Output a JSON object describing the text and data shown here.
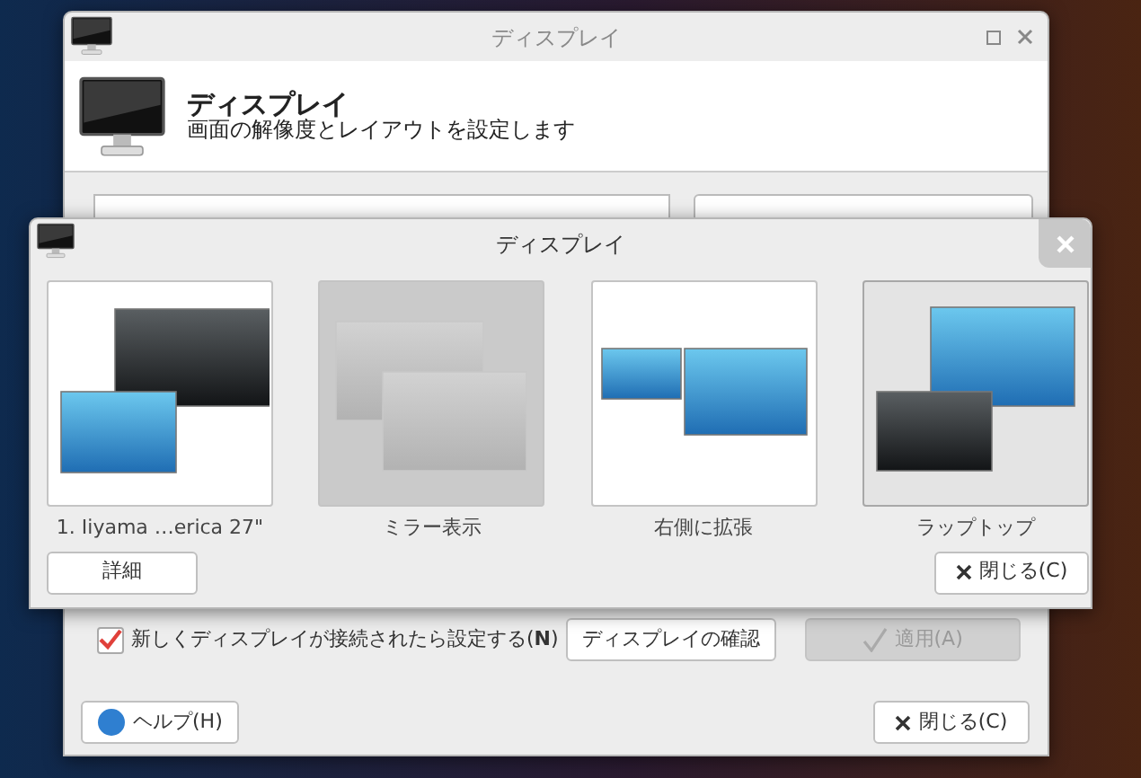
{
  "main_window": {
    "title": "ディスプレイ",
    "header_title": "ディスプレイ",
    "header_subtitle": "画面の解像度とレイアウトを設定します",
    "auto_configure": {
      "label": "新しくディスプレイが接続されたら設定する(**N**)",
      "checked": true
    },
    "buttons": [
      {
        "label": "ディスプレイの確認",
        "disabled": false
      },
      {
        "label": "適用(A)",
        "disabled": true
      }
    ],
    "help_button": "ヘルプ(H)",
    "close_button": "閉じる(C)"
  },
  "dialog": {
    "title": "ディスプレイ",
    "options": [
      {
        "kind": "only-external",
        "label": "1. Iiyama …erica 27\"",
        "selected": false,
        "disabled": false
      },
      {
        "kind": "mirror",
        "label": "ミラー表示",
        "selected": false,
        "disabled": true
      },
      {
        "kind": "extend-right",
        "label": "右側に拡張",
        "selected": false,
        "disabled": false
      },
      {
        "kind": "only-laptop",
        "label": "ラップトップ",
        "selected": true,
        "disabled": false
      }
    ],
    "details_button": "詳細",
    "close_button": "閉じる(C)"
  }
}
